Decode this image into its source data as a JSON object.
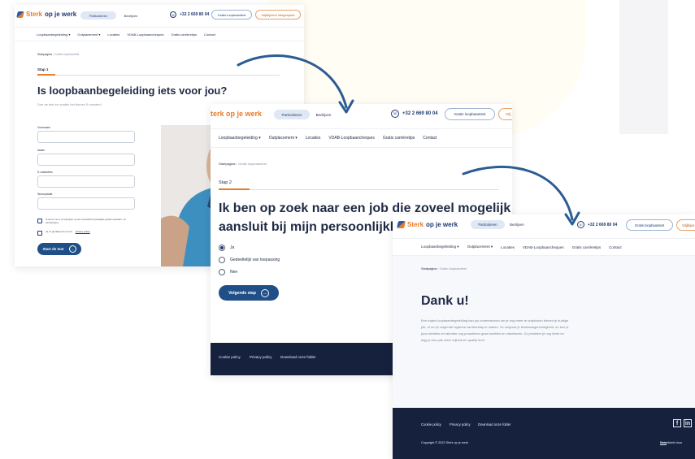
{
  "colors": {
    "navy": "#1f3a70",
    "orange": "#e77b2a",
    "footer": "#16213e",
    "pill": "#dfe8f4"
  },
  "header": {
    "brand_a": "Sterk",
    "brand_b": "op je werk",
    "brand_b2_cut": "terk op je werk",
    "tab_particulieren": "Particulieren",
    "tab_bedrijven": "Bedrijven",
    "phone": "+32 2 669 80 04",
    "btn_gratis": "Gratis loopbaantest",
    "btn_vrijblijvend": "Vrijblijvend infogesprek",
    "btn_vrij_cut": "Vrij",
    "btn_vrijb_cut": "Vrijblijve"
  },
  "nav": {
    "loopbaan": "Loopbaanbegeleiding",
    "outplacement": "Outplacement",
    "locaties": "Locaties",
    "vdab": "VDAB-Loopbaancheques",
    "tips": "Gratis carrièretips",
    "contact": "Contact"
  },
  "breadcrumb": {
    "home": "Startpagina",
    "sep": "›",
    "current": "Gratis loopbaantest"
  },
  "screen1": {
    "step": "Stap 1",
    "title": "Is loopbaanbegeleiding iets voor jou?",
    "subtitle": "Doe de test en ontdek het binnen 5 minuten!",
    "label_voornaam": "Voornaam",
    "label_naam": "Naam",
    "label_email": "E-mailadres",
    "label_woonplaats": "Woonplaats",
    "check_newsletter": "Ik wens me in te schrijven op de nieuwsbrief (wekelijks gratis loopbaan- en carrièretips)",
    "check_privacy_a": "Ja, ik ga akkoord met de",
    "check_privacy_link": "privacy policy",
    "cta": "Start de test"
  },
  "screen2": {
    "step": "Stap 2",
    "title_line1": "Ik ben op zoek naar een job die zoveel mogelijk",
    "title_line2": "aansluit bij mijn persoonlijkh",
    "options": [
      "Ja",
      "Gedeeltelijk van toepassing",
      "Nee"
    ],
    "cta": "Volgende stap",
    "footer": {
      "cookie": "Cookie policy",
      "privacy": "Privacy policy",
      "download": "Download onze folder"
    }
  },
  "screen3": {
    "title": "Dank u!",
    "body": [
      "Een traject loopbaanbegeleiding kan jou ondersteunen om je nog meer te ontplooien binnen je huidige",
      "job, of om je volgende logische carrièrestap te maken. Zo vergroot je bestaansgerechtigheid, en kun je",
      "jouw sterktes en talenten nog proactiever gaan inzetten en valoriseren. Zo prioriteer je nog beter en",
      "krijg je een pak meer vrijheid en quality time."
    ],
    "footer": {
      "cookie": "Cookie policy",
      "privacy": "Privacy policy",
      "download": "Download onze folder",
      "copyright": "Copyright © 2022 Sterk op je werk",
      "credit": "Ontwikkeld door",
      "credit_cut": "hmw",
      "social_f": "f",
      "social_in": "in"
    }
  }
}
